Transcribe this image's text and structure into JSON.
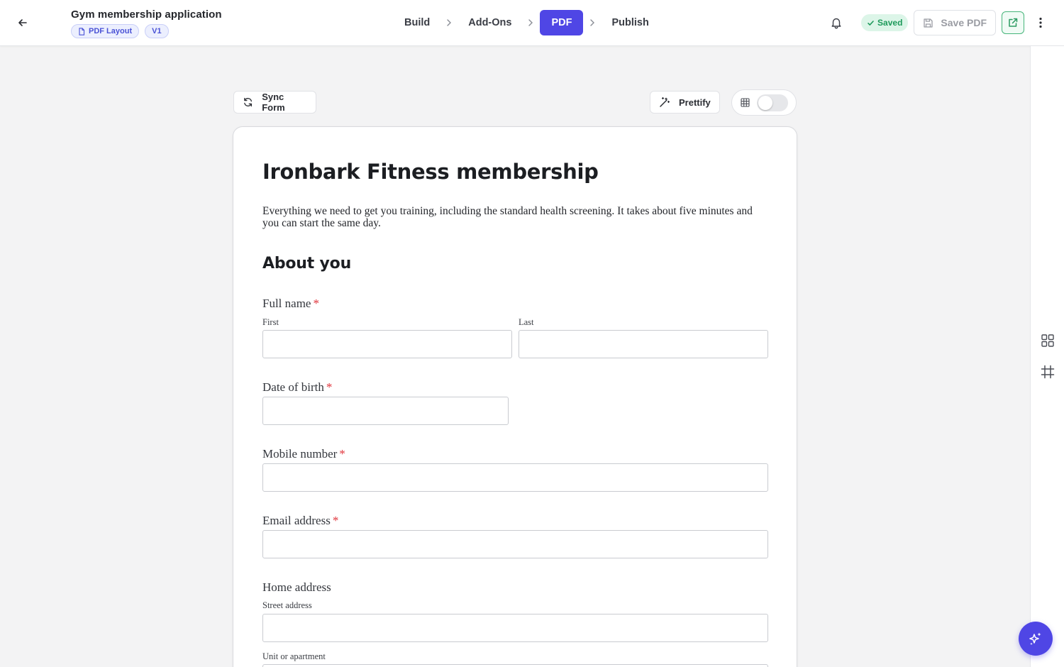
{
  "header": {
    "title": "Gym membership application",
    "badge_layout": "PDF Layout",
    "badge_version": "V1",
    "steps": [
      "Build",
      "Add-Ons",
      "PDF",
      "Publish"
    ],
    "active_step": "PDF",
    "saved_label": "Saved",
    "save_pdf_label": "Save PDF"
  },
  "toolbar": {
    "sync_label": "Sync Form",
    "prettify_label": "Prettify",
    "grid_toggle_on": false
  },
  "document": {
    "title": "Ironbark Fitness membership",
    "description": "Everything we need to get you training, including the standard health screening. It takes about five minutes and you can start the same day.",
    "section": "About you",
    "fields": {
      "full_name": "Full name",
      "first": "First",
      "last": "Last",
      "dob": "Date of birth",
      "mobile": "Mobile number",
      "email": "Email address",
      "home_address": "Home address",
      "street": "Street address",
      "unit": "Unit or apartment"
    },
    "required_mark": "*"
  },
  "colors": {
    "accent": "#4f46e5",
    "success": "#1e9a5b",
    "required": "#e0343b"
  },
  "icons": [
    "back-arrow-icon",
    "file-icon",
    "chevron-right-icon",
    "bell-icon",
    "check-icon",
    "save-icon",
    "external-link-icon",
    "kebab-icon",
    "sync-icon",
    "magic-wand-icon",
    "table-icon",
    "grid-icon",
    "frame-icon",
    "sparkles-icon"
  ]
}
